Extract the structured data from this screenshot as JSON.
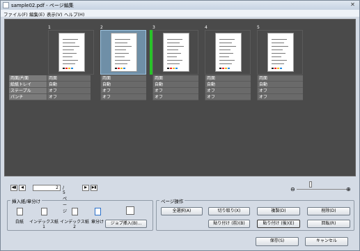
{
  "window": {
    "title": "sample02.pdf - ページ編集",
    "close": "✕"
  },
  "menu": [
    "ファイル(F)",
    "編集(E)",
    "表示(V)",
    "ヘルプ(H)"
  ],
  "pages": [
    {
      "num": "1",
      "selected": false,
      "props": [
        "両面",
        "自動",
        "オフ",
        "オフ"
      ]
    },
    {
      "num": "2",
      "selected": true,
      "props": [
        "両面",
        "自動",
        "オフ",
        "オフ"
      ]
    },
    {
      "num": "3",
      "selected": false,
      "props": [
        "両面",
        "自動",
        "オフ",
        "オフ"
      ]
    },
    {
      "num": "4",
      "selected": false,
      "props": [
        "両面",
        "自動",
        "オフ",
        "オフ"
      ]
    },
    {
      "num": "5",
      "selected": false,
      "props": [
        "両面",
        "自動",
        "オフ",
        "オフ"
      ]
    }
  ],
  "prop_labels": [
    "両面/片面",
    "給紙トレイ",
    "ステープル",
    "パンチ"
  ],
  "nav": {
    "first": "◀▮",
    "prev": "◀",
    "next": "▶",
    "last": "▶▮",
    "current": "2",
    "total": "/ 5ページ"
  },
  "zoom": {
    "minus": "⊖",
    "plus": "⊕"
  },
  "insert_group": {
    "title": "挿入紙/章分け",
    "tools": [
      "白紙",
      "インデックス紙1",
      "インデックス紙2",
      "章分け"
    ],
    "job_insert": "ジョブ挿入(B)..."
  },
  "page_ops": {
    "title": "ページ操作",
    "row1": [
      "全選択(A)",
      "切り取り(X)",
      "複製(D)",
      "削除(D)"
    ],
    "row2": [
      "貼り付け (前)(B)",
      "貼り付け (後)(E)",
      "回転(R)"
    ]
  },
  "footer": {
    "save": "保存(S)",
    "cancel": "キャンセル"
  }
}
